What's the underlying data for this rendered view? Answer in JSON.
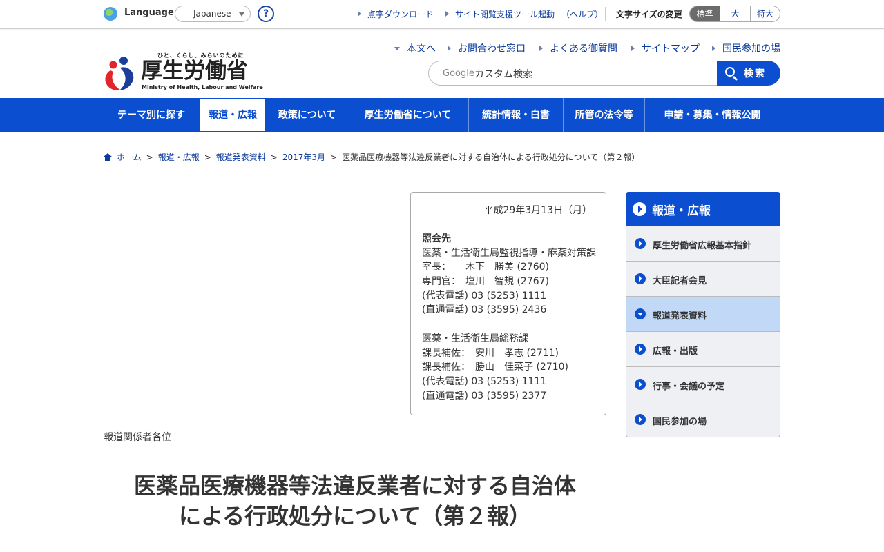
{
  "utility": {
    "language_label": "Language",
    "language_value": "Japanese",
    "help": "?",
    "links": [
      "点字ダウンロード",
      "サイト閲覧支援ツール起動",
      "（ヘルプ）"
    ],
    "font_size_label": "文字サイズの変更",
    "font_sizes": [
      "標準",
      "大",
      "特大"
    ],
    "font_size_active": "標準"
  },
  "header": {
    "logo_tagline": "ひと、くらし、みらいのために",
    "logo_title": "厚生労働省",
    "logo_english": "Ministry of Health, Labour and Welfare",
    "links": [
      "本文へ",
      "お問合わせ窓口",
      "よくある御質問",
      "サイトマップ",
      "国民参加の場"
    ],
    "search_brand": "Google",
    "search_placeholder": "カスタム検索",
    "search_button": "検索"
  },
  "global_nav": {
    "items": [
      "テーマ別に探す",
      "報道・広報",
      "政策について",
      "厚生労働省について",
      "統計情報・白書",
      "所管の法令等",
      "申請・募集・情報公開"
    ],
    "active": "報道・広報"
  },
  "breadcrumb": {
    "links": [
      "ホーム",
      "報道・広報",
      "報道発表資料",
      "2017年3月"
    ],
    "current": "医薬品医療機器等法違反業者に対する自治体による行政処分について（第２報）"
  },
  "contact": {
    "date": "平成29年3月13日（月）",
    "heading": "照会先",
    "dept1": "医薬・生活衛生局監視指導・麻薬対策課",
    "dept1_lines": [
      "室長：　　木下　勝美 (2760)",
      "専門官：　塩川　智規 (2767)",
      "(代表電話) 03 (5253) 1111",
      "(直通電話) 03 (3595) 2436"
    ],
    "dept2": "医薬・生活衛生局総務課",
    "dept2_lines": [
      "課長補佐：　安川　孝志 (2711)",
      "課長補佐：　勝山　佳菜子 (2710)",
      "(代表電話) 03 (5253) 1111",
      "(直通電話) 03 (3595) 2377"
    ]
  },
  "addressee": "報道関係者各位",
  "title_line1": "医薬品医療機器等法違反業者に対する自治体",
  "title_line2": "による行政処分について（第２報）",
  "side_nav": {
    "heading": "報道・広報",
    "items": [
      "厚生労働省広報基本指針",
      "大臣記者会見",
      "報道発表資料",
      "広報・出版",
      "行事・会議の予定",
      "国民参加の場"
    ],
    "current": "報道発表資料"
  },
  "colors": {
    "brand_blue": "#0b4fd0",
    "link_blue": "#0b3b9c",
    "current_item": "#c2d8f7"
  }
}
